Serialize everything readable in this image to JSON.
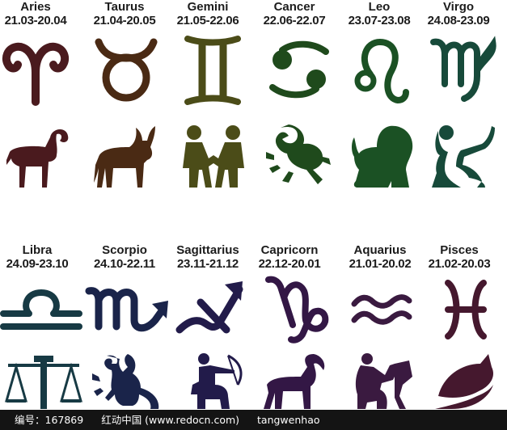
{
  "signs": [
    {
      "name": "Aries",
      "dates": "21.03-20.04",
      "glyph_icon": "aries-glyph-icon",
      "figure_icon": "ram-figure-icon",
      "color": "#4a1a1e"
    },
    {
      "name": "Taurus",
      "dates": "21.04-20.05",
      "glyph_icon": "taurus-glyph-icon",
      "figure_icon": "bull-figure-icon",
      "color": "#4a2a14"
    },
    {
      "name": "Gemini",
      "dates": "21.05-22.06",
      "glyph_icon": "gemini-glyph-icon",
      "figure_icon": "twins-figure-icon",
      "color": "#4b4c18"
    },
    {
      "name": "Cancer",
      "dates": "22.06-22.07",
      "glyph_icon": "cancer-glyph-icon",
      "figure_icon": "crab-figure-icon",
      "color": "#1f4a1c"
    },
    {
      "name": "Leo",
      "dates": "23.07-23.08",
      "glyph_icon": "leo-glyph-icon",
      "figure_icon": "lion-figure-icon",
      "color": "#1b5124"
    },
    {
      "name": "Virgo",
      "dates": "24.08-23.09",
      "glyph_icon": "virgo-glyph-icon",
      "figure_icon": "maiden-figure-icon",
      "color": "#174a3a"
    },
    {
      "name": "Libra",
      "dates": "24.09-23.10",
      "glyph_icon": "libra-glyph-icon",
      "figure_icon": "scales-figure-icon",
      "color": "#173a44"
    },
    {
      "name": "Scorpio",
      "dates": "24.10-22.11",
      "glyph_icon": "scorpio-glyph-icon",
      "figure_icon": "scorpion-figure-icon",
      "color": "#1a244a"
    },
    {
      "name": "Sagittarius",
      "dates": "23.11-21.12",
      "glyph_icon": "sagittarius-glyph-icon",
      "figure_icon": "archer-figure-icon",
      "color": "#221b4a"
    },
    {
      "name": "Capricorn",
      "dates": "22.12-20.01",
      "glyph_icon": "capricorn-glyph-icon",
      "figure_icon": "goat-figure-icon",
      "color": "#331745"
    },
    {
      "name": "Aquarius",
      "dates": "21.01-20.02",
      "glyph_icon": "aquarius-glyph-icon",
      "figure_icon": "water-bearer-figure-icon",
      "color": "#3a1a40"
    },
    {
      "name": "Pisces",
      "dates": "21.02-20.03",
      "glyph_icon": "pisces-glyph-icon",
      "figure_icon": "fish-figure-icon",
      "color": "#45182e"
    }
  ],
  "footer": {
    "id_text": "编号：167869",
    "site_text": "红动中国 (www.redocn.com)",
    "author_text": "tangwenhao"
  }
}
